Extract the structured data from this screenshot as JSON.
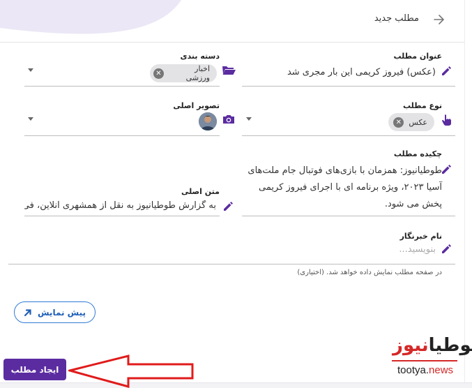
{
  "header": {
    "title": "مطلب جدید"
  },
  "fields": {
    "title": {
      "label": "عنوان مطلب",
      "value": "(عکس) فیروز کریمی این بار مجری شد"
    },
    "category": {
      "label": "دسته بندی",
      "chip": "اخبار ورزشی"
    },
    "type": {
      "label": "نوع مطلب",
      "chip": "عکس"
    },
    "image": {
      "label": "تصویر اصلی"
    },
    "summary": {
      "label": "چکیده مطلب",
      "value": "طوطیانیوز: همزمان با بازی‌های فوتبال جام ملت‌های آسیا ۲۰۲۳، ویژه برنامه ای با اجرای فیروز کریمی پخش می شود."
    },
    "body": {
      "label": "متن اصلی",
      "value": "به گزارش طوطیانیوز به نقل از همشهری آنلاین، فی"
    },
    "reporter": {
      "label": "نام خبرنگار",
      "placeholder": "بنویسید...",
      "help": "در صفحه مطلب نمایش داده خواهد شد. (اختیاری)"
    }
  },
  "buttons": {
    "preview": "پیش نمایش",
    "create": "ایجاد مطلب"
  },
  "logo": {
    "fa_main": "طوطیا",
    "fa_accent": "نیوز",
    "en_main": "tootya.",
    "en_accent": "news"
  },
  "colors": {
    "accent": "#5b2ca0",
    "icon": "#5b2ca0",
    "preview_border": "#2f7bd6",
    "logo_red": "#d62828",
    "annotation_arrow": "#e01b1b"
  },
  "icons": {
    "back": "arrow-right-icon",
    "edit": "pencil-icon",
    "folder": "folder-open-icon",
    "touch": "hand-pointer-icon",
    "camera": "camera-icon",
    "external": "arrow-up-right-icon",
    "dropdown": "caret-down-icon",
    "remove": "close-circle-icon"
  }
}
